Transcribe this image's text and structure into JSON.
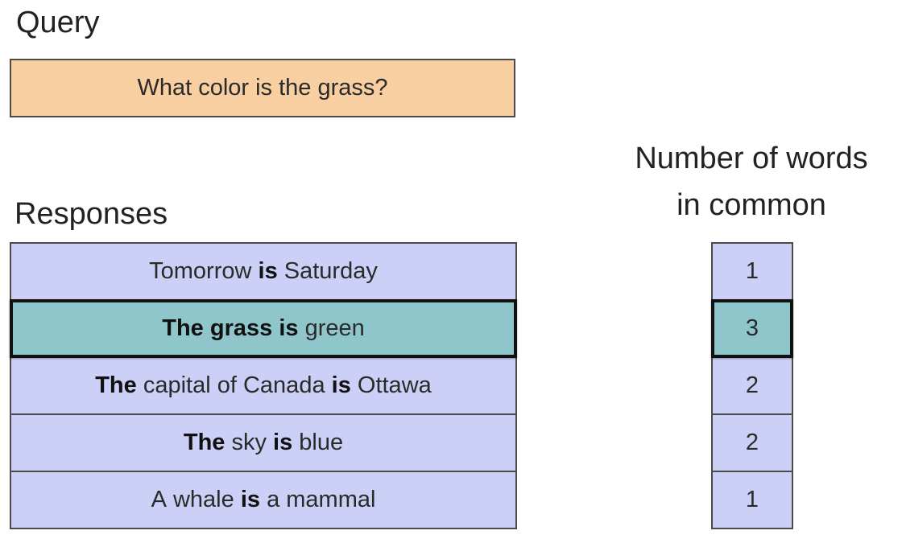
{
  "query": {
    "heading": "Query",
    "text": "What color is the grass?",
    "fill_color": "#f8cfa0"
  },
  "responses": {
    "heading": "Responses",
    "fill_color": "#ccd0f6",
    "highlight_color": "#8fc6cc",
    "items": [
      {
        "words": [
          {
            "text": "Tomorrow",
            "bold": false
          },
          {
            "text": "is",
            "bold": true
          },
          {
            "text": "Saturday",
            "bold": false
          }
        ],
        "selected": false
      },
      {
        "words": [
          {
            "text": "The",
            "bold": true
          },
          {
            "text": "grass",
            "bold": true
          },
          {
            "text": "is",
            "bold": true
          },
          {
            "text": "green",
            "bold": false
          }
        ],
        "selected": true
      },
      {
        "words": [
          {
            "text": "The",
            "bold": true
          },
          {
            "text": "capital",
            "bold": false
          },
          {
            "text": "of",
            "bold": false
          },
          {
            "text": "Canada",
            "bold": false
          },
          {
            "text": "is",
            "bold": true
          },
          {
            "text": "Ottawa",
            "bold": false
          }
        ],
        "selected": false
      },
      {
        "words": [
          {
            "text": "The",
            "bold": true
          },
          {
            "text": "sky",
            "bold": false
          },
          {
            "text": "is",
            "bold": true
          },
          {
            "text": "blue",
            "bold": false
          }
        ],
        "selected": false
      },
      {
        "words": [
          {
            "text": "A",
            "bold": false
          },
          {
            "text": "whale",
            "bold": false
          },
          {
            "text": "is",
            "bold": true
          },
          {
            "text": "a",
            "bold": false
          },
          {
            "text": "mammal",
            "bold": false
          }
        ],
        "selected": false
      }
    ]
  },
  "word_counts": {
    "heading_line1": "Number of words",
    "heading_line2": "in common",
    "values": [
      "1",
      "3",
      "2",
      "2",
      "1"
    ]
  }
}
